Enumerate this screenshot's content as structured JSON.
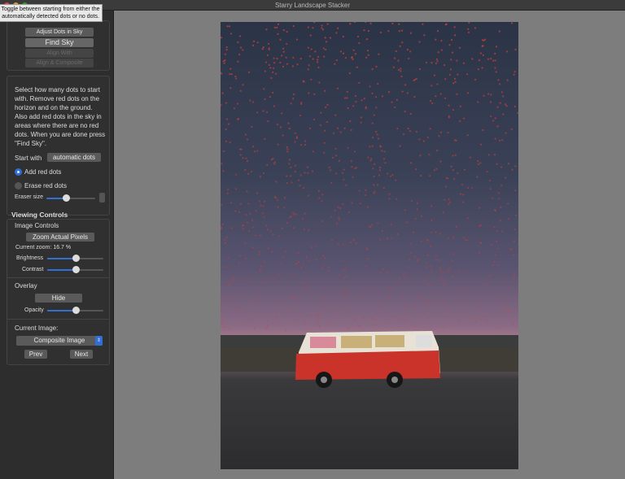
{
  "window": {
    "title": "Starry Landscape Stacker"
  },
  "tooltip": "Toggle between starting from either the automatically detected dots or no dots.",
  "steps": {
    "adjust": "Adjust Dots in Sky",
    "find": "Find Sky",
    "align": "Align With",
    "composite": "Align & Composite"
  },
  "instructions": "Select how many dots to start with. Remove red dots on the horizon and on the ground. Also add red dots in the sky in areas where there are no red dots. When you are done press \"Find Sky\".",
  "start_with": {
    "label": "Start with",
    "value": "automatic dots"
  },
  "mode": {
    "add": "Add red dots",
    "erase": "Erase red dots",
    "selected": "add"
  },
  "eraser": {
    "label": "Eraser size",
    "value": 0.4
  },
  "viewing": {
    "title": "Viewing Controls",
    "image_controls": "Image Controls",
    "zoom_button": "Zoom Actual Pixels",
    "zoom_label": "Current zoom:",
    "zoom_value": "16.7",
    "zoom_unit": "%",
    "brightness_label": "Brightness",
    "brightness": 0.5,
    "contrast_label": "Contrast",
    "contrast": 0.5
  },
  "overlay": {
    "title": "Overlay",
    "hide": "Hide",
    "opacity_label": "Opacity",
    "opacity": 0.5
  },
  "current": {
    "label": "Current Image:",
    "value": "Composite Image",
    "prev": "Prev",
    "next": "Next"
  },
  "colors": {
    "accent": "#2f6fd6",
    "dot": "#d0403a"
  }
}
